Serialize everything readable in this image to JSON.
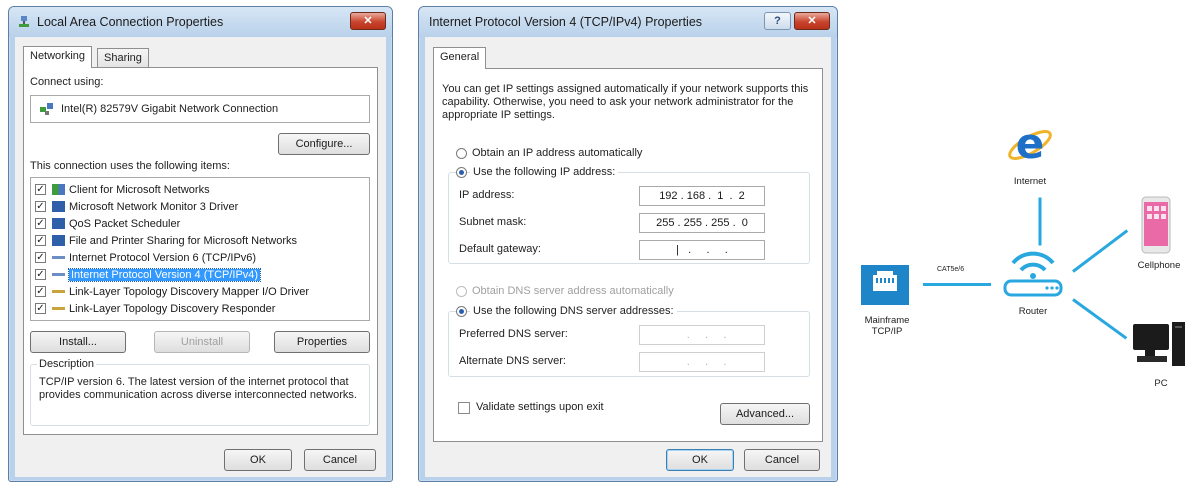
{
  "dialog1": {
    "title": "Local Area Connection Properties",
    "close_label": "✕",
    "tabs": [
      "Networking",
      "Sharing"
    ],
    "connect_using_label": "Connect using:",
    "adapter_name": "Intel(R) 82579V Gigabit Network Connection",
    "configure_label": "Configure...",
    "items_label": "This connection uses the following items:",
    "items": [
      {
        "label": "Client for Microsoft Networks",
        "checked": true
      },
      {
        "label": "Microsoft Network Monitor 3 Driver",
        "checked": true
      },
      {
        "label": "QoS Packet Scheduler",
        "checked": true
      },
      {
        "label": "File and Printer Sharing for Microsoft Networks",
        "checked": true
      },
      {
        "label": "Internet Protocol Version 6 (TCP/IPv6)",
        "checked": true
      },
      {
        "label": "Internet Protocol Version 4 (TCP/IPv4)",
        "checked": true,
        "selected": true
      },
      {
        "label": "Link-Layer Topology Discovery Mapper I/O Driver",
        "checked": true
      },
      {
        "label": "Link-Layer Topology Discovery Responder",
        "checked": true
      }
    ],
    "install_label": "Install...",
    "uninstall_label": "Uninstall",
    "properties_label": "Properties",
    "description_title": "Description",
    "description_text": "TCP/IP version 6. The latest version of the internet protocol that provides communication across diverse interconnected networks.",
    "ok_label": "OK",
    "cancel_label": "Cancel"
  },
  "dialog2": {
    "title": "Internet Protocol Version 4 (TCP/IPv4) Properties",
    "help_label": "?",
    "close_label": "✕",
    "tab": "General",
    "intro_text": "You can get IP settings assigned automatically if your network supports this capability. Otherwise, you need to ask your network administrator for the appropriate IP settings.",
    "obtain_ip_auto_label": "Obtain an IP address automatically",
    "use_following_ip_label": "Use the following IP address:",
    "ip_address_label": "IP address:",
    "ip_address_value": "192 . 168 .  1  .  2",
    "subnet_mask_label": "Subnet mask:",
    "subnet_mask_value": "255 . 255 . 255 .  0",
    "default_gateway_label": "Default gateway:",
    "default_gateway_value": "|   .     .     .",
    "obtain_dns_auto_label": "Obtain DNS server address automatically",
    "use_following_dns_label": "Use the following DNS server addresses:",
    "preferred_dns_label": "Preferred DNS server:",
    "preferred_dns_value": "   .     .     .",
    "alternate_dns_label": "Alternate DNS server:",
    "alternate_dns_value": "   .     .     .",
    "validate_label": "Validate settings upon exit",
    "advanced_label": "Advanced...",
    "ok_label": "OK",
    "cancel_label": "Cancel"
  },
  "diagram": {
    "internet_label": "Internet",
    "cellphone_label": "Cellphone",
    "router_label": "Router",
    "pc_label": "PC",
    "mainframe_label_line1": "Mainframe",
    "mainframe_label_line2": "TCP/IP",
    "cable_label": "CAT5e/6",
    "accent_color": "#29a8e0",
    "ie_color": "#1e6fc8"
  }
}
